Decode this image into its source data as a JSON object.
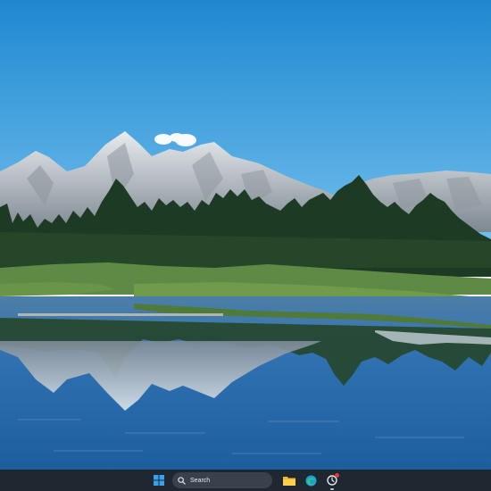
{
  "wallpaper": {
    "description_icon": "mountain-lake-wallpaper",
    "sky_top": "#1f88d0",
    "sky_bottom": "#79c4ef"
  },
  "taskbar": {
    "background": "#1f2730",
    "start_icon": "windows-logo-icon",
    "search": {
      "icon": "search-icon",
      "label": "Search"
    },
    "apps": [
      {
        "name": "file-explorer",
        "icon": "folder-icon"
      },
      {
        "name": "edge-browser",
        "icon": "edge-icon"
      },
      {
        "name": "app-with-notification",
        "icon": "notification-app-icon",
        "badge": true
      }
    ]
  }
}
